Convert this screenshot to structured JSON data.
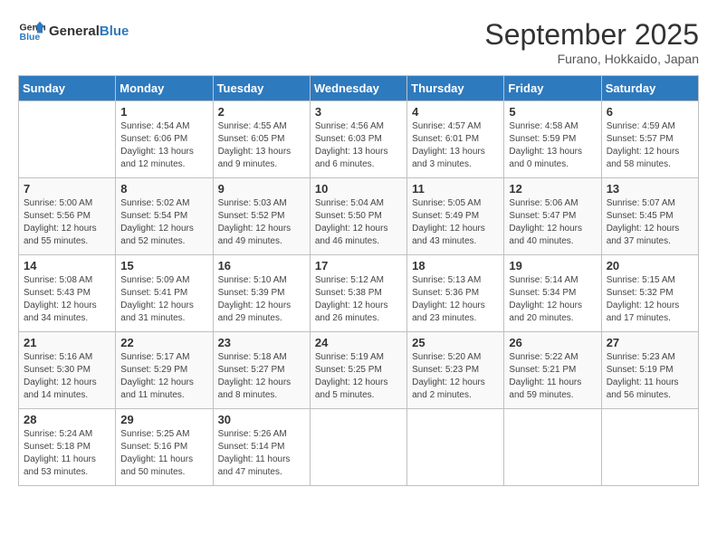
{
  "header": {
    "logo_line1": "General",
    "logo_line2": "Blue",
    "month": "September 2025",
    "location": "Furano, Hokkaido, Japan"
  },
  "weekdays": [
    "Sunday",
    "Monday",
    "Tuesday",
    "Wednesday",
    "Thursday",
    "Friday",
    "Saturday"
  ],
  "weeks": [
    [
      {
        "day": "",
        "info": ""
      },
      {
        "day": "1",
        "info": "Sunrise: 4:54 AM\nSunset: 6:06 PM\nDaylight: 13 hours\nand 12 minutes."
      },
      {
        "day": "2",
        "info": "Sunrise: 4:55 AM\nSunset: 6:05 PM\nDaylight: 13 hours\nand 9 minutes."
      },
      {
        "day": "3",
        "info": "Sunrise: 4:56 AM\nSunset: 6:03 PM\nDaylight: 13 hours\nand 6 minutes."
      },
      {
        "day": "4",
        "info": "Sunrise: 4:57 AM\nSunset: 6:01 PM\nDaylight: 13 hours\nand 3 minutes."
      },
      {
        "day": "5",
        "info": "Sunrise: 4:58 AM\nSunset: 5:59 PM\nDaylight: 13 hours\nand 0 minutes."
      },
      {
        "day": "6",
        "info": "Sunrise: 4:59 AM\nSunset: 5:57 PM\nDaylight: 12 hours\nand 58 minutes."
      }
    ],
    [
      {
        "day": "7",
        "info": "Sunrise: 5:00 AM\nSunset: 5:56 PM\nDaylight: 12 hours\nand 55 minutes."
      },
      {
        "day": "8",
        "info": "Sunrise: 5:02 AM\nSunset: 5:54 PM\nDaylight: 12 hours\nand 52 minutes."
      },
      {
        "day": "9",
        "info": "Sunrise: 5:03 AM\nSunset: 5:52 PM\nDaylight: 12 hours\nand 49 minutes."
      },
      {
        "day": "10",
        "info": "Sunrise: 5:04 AM\nSunset: 5:50 PM\nDaylight: 12 hours\nand 46 minutes."
      },
      {
        "day": "11",
        "info": "Sunrise: 5:05 AM\nSunset: 5:49 PM\nDaylight: 12 hours\nand 43 minutes."
      },
      {
        "day": "12",
        "info": "Sunrise: 5:06 AM\nSunset: 5:47 PM\nDaylight: 12 hours\nand 40 minutes."
      },
      {
        "day": "13",
        "info": "Sunrise: 5:07 AM\nSunset: 5:45 PM\nDaylight: 12 hours\nand 37 minutes."
      }
    ],
    [
      {
        "day": "14",
        "info": "Sunrise: 5:08 AM\nSunset: 5:43 PM\nDaylight: 12 hours\nand 34 minutes."
      },
      {
        "day": "15",
        "info": "Sunrise: 5:09 AM\nSunset: 5:41 PM\nDaylight: 12 hours\nand 31 minutes."
      },
      {
        "day": "16",
        "info": "Sunrise: 5:10 AM\nSunset: 5:39 PM\nDaylight: 12 hours\nand 29 minutes."
      },
      {
        "day": "17",
        "info": "Sunrise: 5:12 AM\nSunset: 5:38 PM\nDaylight: 12 hours\nand 26 minutes."
      },
      {
        "day": "18",
        "info": "Sunrise: 5:13 AM\nSunset: 5:36 PM\nDaylight: 12 hours\nand 23 minutes."
      },
      {
        "day": "19",
        "info": "Sunrise: 5:14 AM\nSunset: 5:34 PM\nDaylight: 12 hours\nand 20 minutes."
      },
      {
        "day": "20",
        "info": "Sunrise: 5:15 AM\nSunset: 5:32 PM\nDaylight: 12 hours\nand 17 minutes."
      }
    ],
    [
      {
        "day": "21",
        "info": "Sunrise: 5:16 AM\nSunset: 5:30 PM\nDaylight: 12 hours\nand 14 minutes."
      },
      {
        "day": "22",
        "info": "Sunrise: 5:17 AM\nSunset: 5:29 PM\nDaylight: 12 hours\nand 11 minutes."
      },
      {
        "day": "23",
        "info": "Sunrise: 5:18 AM\nSunset: 5:27 PM\nDaylight: 12 hours\nand 8 minutes."
      },
      {
        "day": "24",
        "info": "Sunrise: 5:19 AM\nSunset: 5:25 PM\nDaylight: 12 hours\nand 5 minutes."
      },
      {
        "day": "25",
        "info": "Sunrise: 5:20 AM\nSunset: 5:23 PM\nDaylight: 12 hours\nand 2 minutes."
      },
      {
        "day": "26",
        "info": "Sunrise: 5:22 AM\nSunset: 5:21 PM\nDaylight: 11 hours\nand 59 minutes."
      },
      {
        "day": "27",
        "info": "Sunrise: 5:23 AM\nSunset: 5:19 PM\nDaylight: 11 hours\nand 56 minutes."
      }
    ],
    [
      {
        "day": "28",
        "info": "Sunrise: 5:24 AM\nSunset: 5:18 PM\nDaylight: 11 hours\nand 53 minutes."
      },
      {
        "day": "29",
        "info": "Sunrise: 5:25 AM\nSunset: 5:16 PM\nDaylight: 11 hours\nand 50 minutes."
      },
      {
        "day": "30",
        "info": "Sunrise: 5:26 AM\nSunset: 5:14 PM\nDaylight: 11 hours\nand 47 minutes."
      },
      {
        "day": "",
        "info": ""
      },
      {
        "day": "",
        "info": ""
      },
      {
        "day": "",
        "info": ""
      },
      {
        "day": "",
        "info": ""
      }
    ]
  ]
}
